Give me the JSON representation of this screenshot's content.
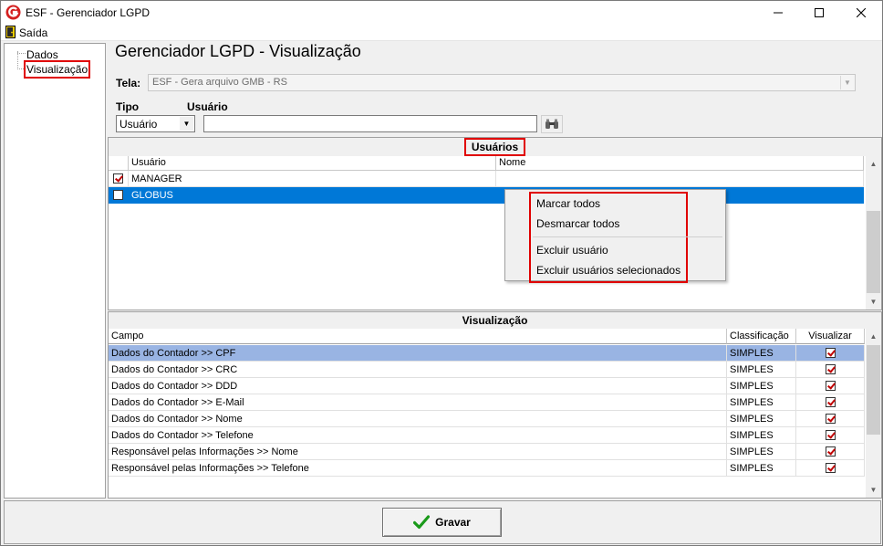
{
  "window": {
    "title": "ESF - Gerenciador LGPD",
    "minimize_icon": "minimize-icon",
    "maximize_icon": "maximize-icon",
    "close_icon": "close-icon"
  },
  "menu": {
    "items": [
      {
        "label": "Saída",
        "icon": "exit-door-icon"
      }
    ]
  },
  "sidebar": {
    "items": [
      {
        "label": "Dados"
      },
      {
        "label": "Visualização",
        "selected": true
      }
    ]
  },
  "page": {
    "title": "Gerenciador LGPD - Visualização",
    "tela_label": "Tela:",
    "tela_value": "ESF - Gera arquivo GMB - RS",
    "tipo_label": "Tipo",
    "tipo_value": "Usuário",
    "usuario_label": "Usuário",
    "usuario_value": "",
    "search_icon": "binoculars-icon"
  },
  "usuarios": {
    "title": "Usuários",
    "columns": [
      "Usuário",
      "Nome"
    ],
    "rows": [
      {
        "checked": true,
        "usuario": "MANAGER",
        "nome": ""
      },
      {
        "checked": false,
        "usuario": "GLOBUS",
        "nome": "",
        "selected": true
      }
    ]
  },
  "context_menu": {
    "items": [
      "Marcar todos",
      "Desmarcar todos",
      "Excluir usuário",
      "Excluir usuários selecionados"
    ]
  },
  "visualizacao": {
    "title": "Visualização",
    "columns": [
      "Campo",
      "Classificação",
      "Visualizar"
    ],
    "rows": [
      {
        "campo": "Dados do Contador >> CPF",
        "classificacao": "SIMPLES",
        "visualizar": true,
        "selected": true
      },
      {
        "campo": "Dados do Contador >> CRC",
        "classificacao": "SIMPLES",
        "visualizar": true
      },
      {
        "campo": "Dados do Contador >> DDD",
        "classificacao": "SIMPLES",
        "visualizar": true
      },
      {
        "campo": "Dados do Contador >> E-Mail",
        "classificacao": "SIMPLES",
        "visualizar": true
      },
      {
        "campo": "Dados do Contador >> Nome",
        "classificacao": "SIMPLES",
        "visualizar": true
      },
      {
        "campo": "Dados do Contador >> Telefone",
        "classificacao": "SIMPLES",
        "visualizar": true
      },
      {
        "campo": "Responsável pelas Informações >> Nome",
        "classificacao": "SIMPLES",
        "visualizar": true
      },
      {
        "campo": "Responsável pelas Informações >> Telefone",
        "classificacao": "SIMPLES",
        "visualizar": true
      }
    ]
  },
  "footer": {
    "save_label": "Gravar",
    "save_icon": "green-checkmark-icon"
  },
  "colors": {
    "selected_row": "#0078d7",
    "highlight_row": "#99b4e3",
    "annotation": "#e00000",
    "check_red": "#c00000"
  }
}
